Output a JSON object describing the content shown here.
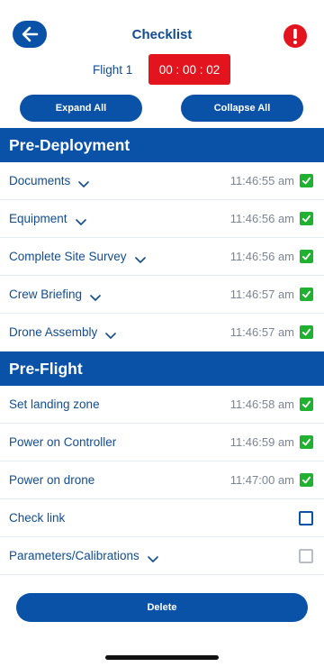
{
  "header": {
    "title": "Checklist"
  },
  "flight": {
    "label": "Flight 1",
    "timer": "00 : 00 : 02"
  },
  "buttons": {
    "expand_all": "Expand All",
    "collapse_all": "Collapse All",
    "delete": "Delete"
  },
  "sections": [
    {
      "title": "Pre-Deployment",
      "items": [
        {
          "label": "Documents",
          "time": "11:46:55 am",
          "checked": true,
          "expandable": true
        },
        {
          "label": "Equipment",
          "time": "11:46:56 am",
          "checked": true,
          "expandable": true
        },
        {
          "label": "Complete Site Survey",
          "time": "11:46:56 am",
          "checked": true,
          "expandable": true
        },
        {
          "label": "Crew Briefing",
          "time": "11:46:57 am",
          "checked": true,
          "expandable": true
        },
        {
          "label": "Drone Assembly",
          "time": "11:46:57 am",
          "checked": true,
          "expandable": true
        }
      ]
    },
    {
      "title": "Pre-Flight",
      "items": [
        {
          "label": "Set landing zone",
          "time": "11:46:58 am",
          "checked": true,
          "expandable": false
        },
        {
          "label": "Power on Controller",
          "time": "11:46:59 am",
          "checked": true,
          "expandable": false
        },
        {
          "label": "Power on drone",
          "time": "11:47:00 am",
          "checked": true,
          "expandable": false
        },
        {
          "label": "Check link",
          "time": "",
          "checked": false,
          "expandable": false
        },
        {
          "label": "Parameters/Calibrations",
          "time": "",
          "checked": false,
          "expandable": true,
          "disabled": true
        }
      ]
    }
  ],
  "colors": {
    "primary": "#0a52a8",
    "timer": "#e3141d",
    "check": "#1fb12f",
    "alert": "#e3141d"
  },
  "icons": {
    "back": "arrow-left-icon",
    "alert": "exclamation-circle-icon",
    "expand": "chevron-down-icon",
    "check": "checkmark-icon"
  }
}
